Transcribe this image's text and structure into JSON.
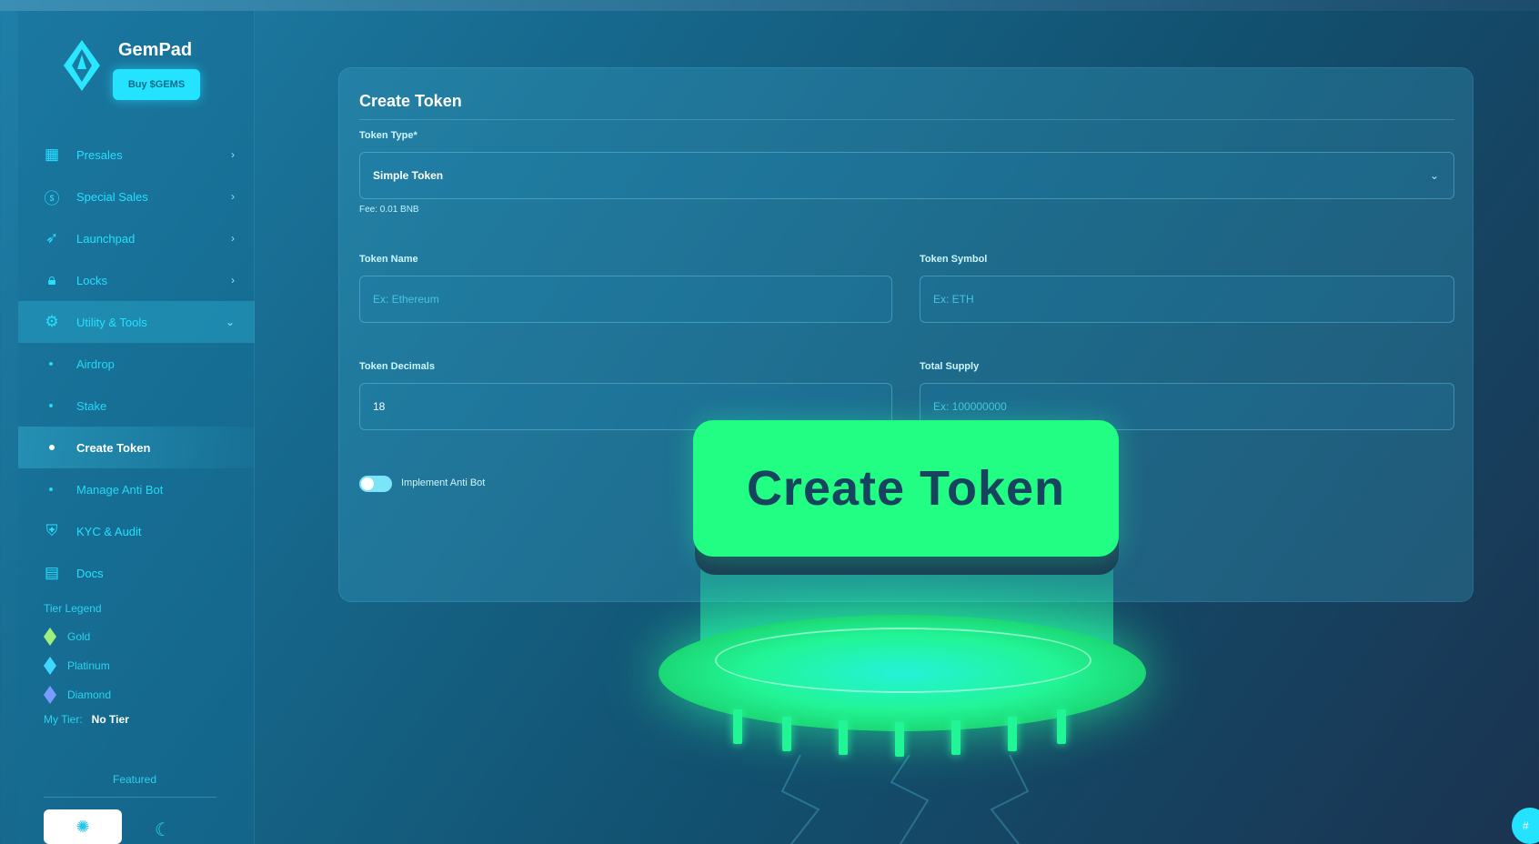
{
  "brand": {
    "name": "GemPad",
    "buy_label": "Buy $GEMS"
  },
  "sidebar": {
    "items": [
      {
        "label": "Presales",
        "icon": "grid-icon"
      },
      {
        "label": "Special Sales",
        "icon": "dollar-icon"
      },
      {
        "label": "Launchpad",
        "icon": "rocket-icon"
      },
      {
        "label": "Locks",
        "icon": "lock-icon"
      },
      {
        "label": "Utility & Tools",
        "icon": "tools-icon"
      }
    ],
    "subitems": [
      "Airdrop",
      "Stake",
      "Create Token",
      "Manage Anti Bot"
    ],
    "bottom_items": [
      {
        "label": "KYC & Audit",
        "icon": "shield-check-icon"
      },
      {
        "label": "Docs",
        "icon": "docs-icon"
      }
    ],
    "tier_legend": {
      "title": "Tier Legend",
      "tiers": [
        "Gold",
        "Platinum",
        "Diamond"
      ],
      "my_tier_label": "My Tier:",
      "my_tier_value": "No Tier"
    },
    "featured": "Featured"
  },
  "form": {
    "title": "Create Token",
    "token_type_label": "Token Type*",
    "token_type_value": "Simple Token",
    "fee": "Fee: 0.01 BNB",
    "token_name_label": "Token Name",
    "token_name_placeholder": "Ex: Ethereum",
    "token_symbol_label": "Token Symbol",
    "token_symbol_placeholder": "Ex: ETH",
    "token_decimals_label": "Token Decimals",
    "token_decimals_value": "18",
    "total_supply_label": "Total Supply",
    "total_supply_placeholder": "Ex: 100000000",
    "anti_bot_label": "Implement Anti Bot"
  },
  "overlay": {
    "big_button_label": "Create Token"
  },
  "colors": {
    "accent": "#23e3ff",
    "button_green": "#22fd84"
  }
}
